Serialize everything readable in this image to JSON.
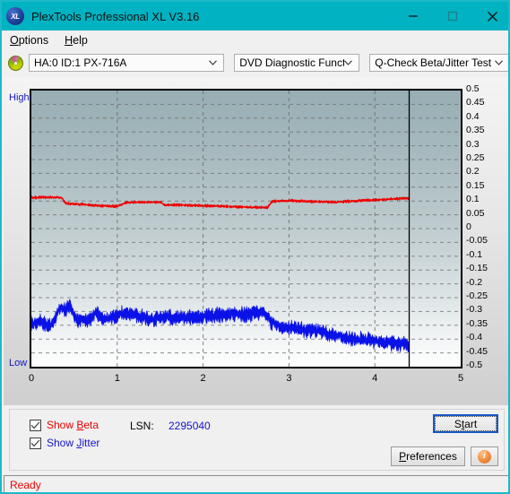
{
  "window": {
    "title": "PlexTools Professional XL V3.16",
    "app_icon": "xl-logo-icon",
    "minimize": "minimize-icon",
    "maximize": "maximize-icon",
    "close": "close-icon",
    "titlebar_color": "#00b2c2"
  },
  "menu": {
    "items": [
      {
        "label": "Options",
        "accel": "O"
      },
      {
        "label": "Help",
        "accel": "H"
      }
    ]
  },
  "toolbar": {
    "drive_icon": "optical-disc-icon",
    "drive": "HA:0 ID:1  PX-716A",
    "function": "DVD Diagnostic Functions",
    "test": "Q-Check Beta/Jitter Test"
  },
  "chart": {
    "high_label": "High",
    "low_label": "Low"
  },
  "controls": {
    "show_beta": {
      "label_pre": "Show ",
      "label_accel": "B",
      "label_post": "eta",
      "checked": true,
      "color": "#ee0000"
    },
    "show_jitter": {
      "label_pre": "Show ",
      "label_accel": "J",
      "label_post": "itter",
      "checked": true,
      "color": "#1515c8"
    },
    "lsn_label": "LSN:",
    "lsn_value": "2295040",
    "start_pre": "S",
    "start_accel": "t",
    "start_post": "art",
    "preferences_pre": "",
    "preferences_accel": "P",
    "preferences_post": "references",
    "info_glyph": "i"
  },
  "status": {
    "text": "Ready"
  },
  "chart_data": {
    "type": "line",
    "title": "Q-Check Beta/Jitter Test",
    "xlabel": "",
    "ylabel": "",
    "xlim": [
      0,
      5
    ],
    "ylim": [
      -0.5,
      0.5
    ],
    "xticks": [
      0,
      1,
      2,
      3,
      4,
      5
    ],
    "yticks": [
      0.5,
      0.45,
      0.4,
      0.35,
      0.3,
      0.25,
      0.2,
      0.15,
      0.1,
      0.05,
      0,
      -0.05,
      -0.1,
      -0.15,
      -0.2,
      -0.25,
      -0.3,
      -0.35,
      -0.4,
      -0.45,
      -0.5
    ],
    "grid": true,
    "legend": [
      "Show Beta",
      "Show Jitter"
    ],
    "data_end_x": 4.4,
    "annotations": [
      {
        "text": "High",
        "position": "top-left-outside"
      },
      {
        "text": "Low",
        "position": "bottom-left-outside"
      },
      {
        "text": "end-of-data marker",
        "type": "vline",
        "x": 4.4
      }
    ],
    "series": [
      {
        "name": "Beta",
        "color": "#ee0000",
        "noise": 0.006,
        "x": [
          0.0,
          0.1,
          0.2,
          0.3,
          0.35,
          0.4,
          0.5,
          0.6,
          0.7,
          0.75,
          0.8,
          0.9,
          1.0,
          1.1,
          1.2,
          1.3,
          1.4,
          1.5,
          1.55,
          1.6,
          1.7,
          1.8,
          1.9,
          2.0,
          2.1,
          2.2,
          2.3,
          2.4,
          2.5,
          2.6,
          2.7,
          2.75,
          2.8,
          2.9,
          3.0,
          3.1,
          3.2,
          3.3,
          3.4,
          3.5,
          3.6,
          3.7,
          3.8,
          3.9,
          4.0,
          4.1,
          4.2,
          4.3,
          4.4
        ],
        "y": [
          0.112,
          0.113,
          0.114,
          0.113,
          0.112,
          0.092,
          0.089,
          0.088,
          0.085,
          0.084,
          0.083,
          0.082,
          0.081,
          0.094,
          0.096,
          0.095,
          0.096,
          0.097,
          0.086,
          0.085,
          0.086,
          0.085,
          0.084,
          0.083,
          0.082,
          0.081,
          0.08,
          0.079,
          0.078,
          0.077,
          0.077,
          0.076,
          0.098,
          0.1,
          0.101,
          0.1,
          0.099,
          0.098,
          0.097,
          0.096,
          0.097,
          0.099,
          0.101,
          0.103,
          0.104,
          0.105,
          0.107,
          0.109,
          0.11
        ]
      },
      {
        "name": "Jitter",
        "color": "#0b12e8",
        "noise": 0.03,
        "x": [
          0.0,
          0.05,
          0.1,
          0.15,
          0.2,
          0.25,
          0.3,
          0.35,
          0.4,
          0.45,
          0.5,
          0.55,
          0.6,
          0.65,
          0.7,
          0.75,
          0.8,
          0.85,
          0.9,
          0.95,
          1.0,
          1.1,
          1.2,
          1.3,
          1.4,
          1.5,
          1.6,
          1.7,
          1.8,
          1.9,
          2.0,
          2.1,
          2.2,
          2.3,
          2.4,
          2.5,
          2.6,
          2.7,
          2.8,
          2.9,
          3.0,
          3.1,
          3.2,
          3.3,
          3.4,
          3.5,
          3.6,
          3.7,
          3.8,
          3.9,
          4.0,
          4.1,
          4.2,
          4.3,
          4.4
        ],
        "y": [
          -0.345,
          -0.34,
          -0.335,
          -0.345,
          -0.355,
          -0.35,
          -0.3,
          -0.285,
          -0.295,
          -0.275,
          -0.32,
          -0.335,
          -0.33,
          -0.335,
          -0.32,
          -0.3,
          -0.32,
          -0.33,
          -0.325,
          -0.32,
          -0.315,
          -0.305,
          -0.31,
          -0.32,
          -0.33,
          -0.325,
          -0.318,
          -0.32,
          -0.325,
          -0.322,
          -0.318,
          -0.315,
          -0.312,
          -0.31,
          -0.308,
          -0.312,
          -0.305,
          -0.3,
          -0.34,
          -0.355,
          -0.36,
          -0.362,
          -0.37,
          -0.368,
          -0.375,
          -0.385,
          -0.39,
          -0.398,
          -0.4,
          -0.402,
          -0.408,
          -0.412,
          -0.415,
          -0.418,
          -0.42
        ]
      }
    ]
  }
}
